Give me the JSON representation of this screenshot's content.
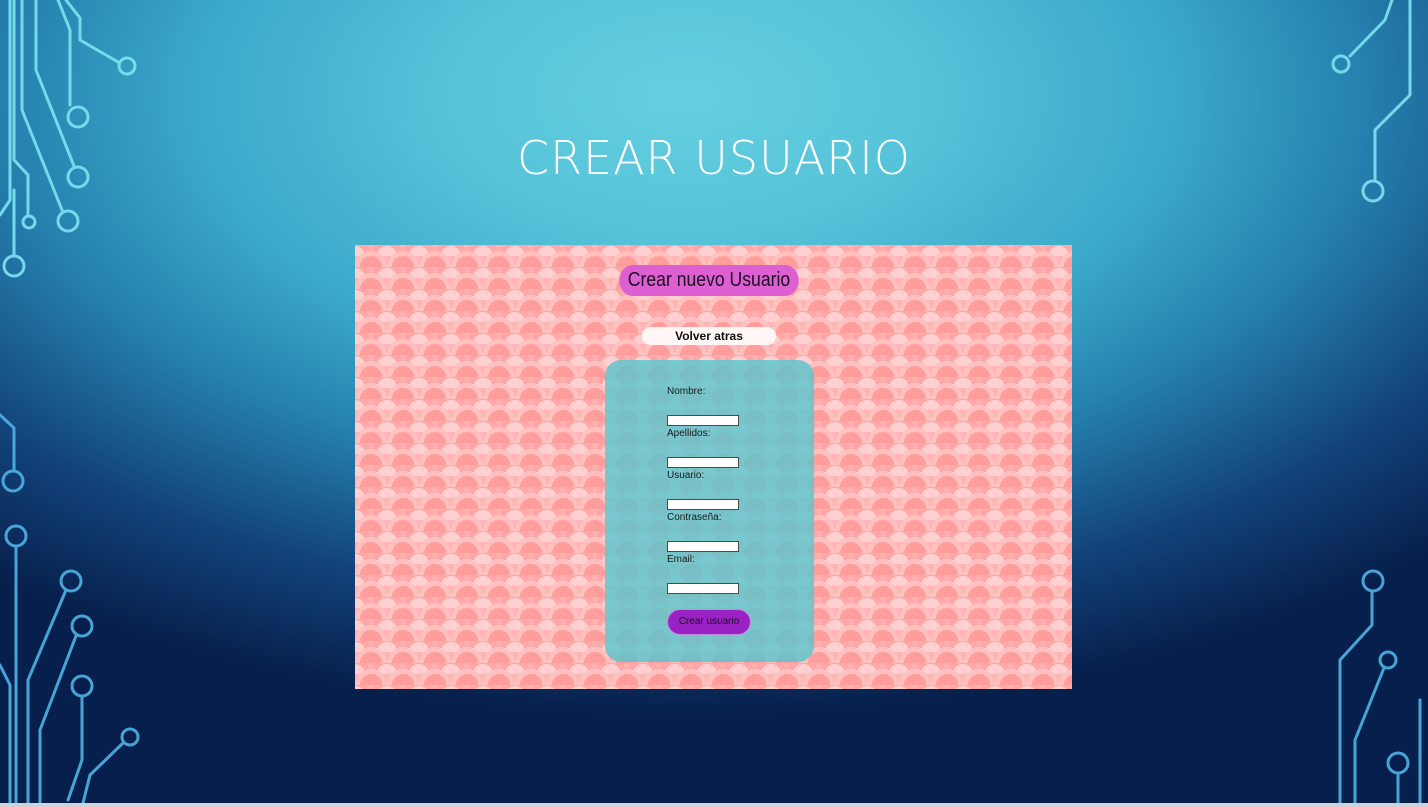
{
  "slide": {
    "title": "Crear usuario"
  },
  "app": {
    "heading": "Crear nuevo Usuario",
    "back_label": "Volver atras",
    "form": {
      "fields": [
        {
          "label": "Nombre:",
          "value": ""
        },
        {
          "label": "Apellidos:",
          "value": ""
        },
        {
          "label": "Usuario:",
          "value": ""
        },
        {
          "label": "Contraseña:",
          "value": ""
        },
        {
          "label": "Email:",
          "value": ""
        }
      ],
      "submit_label": "Crear usuario"
    }
  },
  "colors": {
    "heading_bg": "#de5fd1",
    "submit_bg": "#9a22c5",
    "panel_bg": "#5cc6ce",
    "pattern_bg": "#ffb3b3"
  }
}
